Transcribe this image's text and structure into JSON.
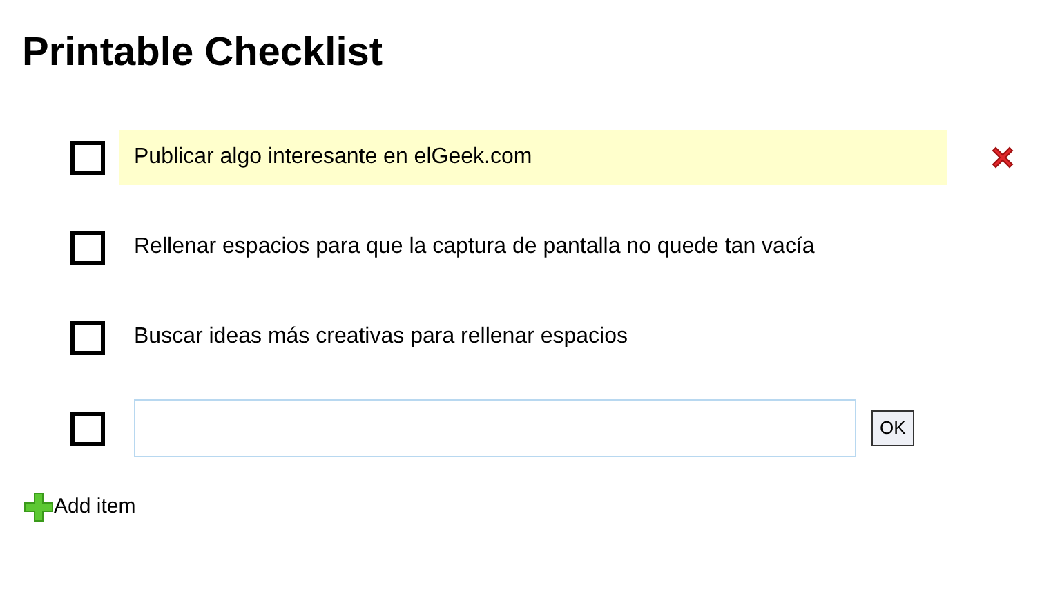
{
  "title": "Printable Checklist",
  "items": [
    {
      "text": "Publicar algo interesante en elGeek.com",
      "checked": false,
      "highlighted": true
    },
    {
      "text": "Rellenar espacios para que la captura de pantalla no quede tan vacía",
      "checked": false,
      "highlighted": false
    },
    {
      "text": "Buscar ideas más creativas para rellenar espacios",
      "checked": false,
      "highlighted": false
    }
  ],
  "new_item": {
    "checked": false,
    "button": "OK"
  },
  "add_link": "Add item"
}
